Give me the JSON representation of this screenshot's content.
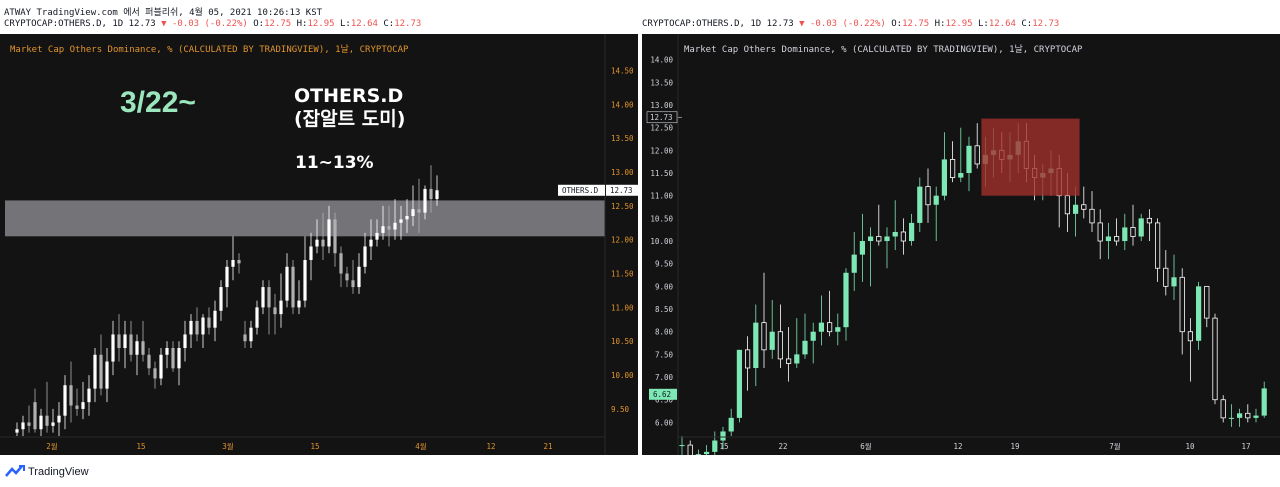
{
  "header": {
    "publish_line": "ATWAY TradingView.com 에서 퍼블리쉬, 4월 05, 2021 10:26:13 KST",
    "left_symbol": "CRYPTOCAP:OTHERS.D, 1D 12.73",
    "right_symbol": "CRYPTOCAP:OTHERS.D, 1D 12.73",
    "change": "▼ -0.03 (-0.22%)",
    "o_label": "O:",
    "o_value": "12.75",
    "h_label": "H:",
    "h_value": "12.95",
    "l_label": "L:",
    "l_value": "12.64",
    "c_label": "C:",
    "c_value": "12.73"
  },
  "colors": {
    "panel_bg": "#131313",
    "left_title": "#e0942c",
    "right_title": "#d1d4dc",
    "left_axis": "#e0942c",
    "right_axis": "#d1d4dc",
    "candle_up_left": "#ffffff",
    "candle_down_left": "#b0b0b0",
    "candle_up_right": "#7ee8b4",
    "candle_down_right": "#ffffff",
    "zone": "#8a8a8f",
    "box": "#a3302b",
    "annotation_green": "#9be6bc",
    "annotation_white": "#ffffff"
  },
  "left_panel": {
    "title": "Market Cap Others Dominance, % (CALCULATED BY TRADINGVIEW), 1날, CRYPTOCAP",
    "annotation_date": "3/22~",
    "annotation_name_1": "OTHERS.D",
    "annotation_name_2": "(잡알트 도미)",
    "annotation_range": "11~13%",
    "price_tag_symbol": "OTHERS.D",
    "price_tag_value": "12.73"
  },
  "right_panel": {
    "title": "Market Cap Others Dominance, % (CALCULATED BY TRADINGVIEW), 1날, CRYPTOCAP",
    "price_tag_value": "12.73",
    "low_tag_value": "6.62"
  },
  "footer": {
    "brand": "TradingView"
  },
  "chart_data": [
    {
      "type": "candlestick",
      "name": "left",
      "ylim": [
        9.1,
        14.95
      ],
      "y_ticks": [
        9.5,
        10.0,
        10.5,
        11.0,
        11.5,
        12.0,
        12.5,
        13.0,
        13.5,
        14.0,
        14.5
      ],
      "x_ticks": [
        "2월",
        "15",
        "3월",
        "15",
        "4월",
        "12",
        "21"
      ],
      "zone": [
        12.05,
        12.58
      ],
      "candles": [
        [
          9.15,
          9.3,
          9.1,
          9.2
        ],
        [
          9.2,
          9.4,
          9.1,
          9.3
        ],
        [
          9.3,
          9.55,
          9.15,
          9.25
        ],
        [
          9.6,
          9.8,
          9.15,
          9.2
        ],
        [
          9.2,
          9.5,
          9.1,
          9.4
        ],
        [
          9.4,
          9.9,
          9.15,
          9.25
        ],
        [
          9.25,
          9.5,
          9.15,
          9.3
        ],
        [
          9.3,
          9.6,
          9.1,
          9.4
        ],
        [
          9.4,
          10.0,
          9.2,
          9.85
        ],
        [
          9.85,
          10.2,
          9.3,
          9.55
        ],
        [
          9.55,
          9.8,
          9.4,
          9.5
        ],
        [
          9.5,
          9.9,
          9.35,
          9.6
        ],
        [
          9.6,
          10.0,
          9.4,
          9.8
        ],
        [
          9.8,
          10.4,
          9.6,
          10.3
        ],
        [
          10.3,
          10.6,
          9.7,
          9.8
        ],
        [
          9.8,
          10.4,
          9.6,
          10.2
        ],
        [
          10.2,
          10.8,
          10.0,
          10.6
        ],
        [
          10.6,
          10.9,
          10.2,
          10.4
        ],
        [
          10.4,
          10.8,
          10.1,
          10.6
        ],
        [
          10.6,
          10.8,
          10.2,
          10.3
        ],
        [
          10.3,
          10.6,
          10.0,
          10.5
        ],
        [
          10.5,
          10.8,
          10.2,
          10.3
        ],
        [
          10.3,
          10.4,
          10.0,
          10.1
        ],
        [
          10.1,
          10.2,
          9.8,
          9.95
        ],
        [
          9.95,
          10.4,
          9.85,
          10.3
        ],
        [
          10.3,
          10.5,
          10.1,
          10.4
        ],
        [
          10.4,
          10.5,
          10.05,
          10.1
        ],
        [
          10.1,
          10.5,
          9.85,
          10.4
        ],
        [
          10.4,
          10.8,
          10.2,
          10.6
        ],
        [
          10.6,
          10.9,
          10.4,
          10.8
        ],
        [
          10.8,
          11.0,
          10.5,
          10.6
        ],
        [
          10.6,
          10.9,
          10.4,
          10.85
        ],
        [
          10.85,
          11.0,
          10.6,
          10.7
        ],
        [
          10.7,
          11.1,
          10.5,
          10.95
        ],
        [
          10.95,
          11.4,
          10.8,
          11.3
        ],
        [
          11.3,
          11.7,
          11.0,
          11.6
        ],
        [
          11.6,
          12.05,
          11.4,
          11.7
        ],
        [
          11.7,
          11.8,
          11.5,
          11.65
        ],
        [
          10.6,
          10.8,
          10.4,
          10.5
        ],
        [
          10.5,
          10.8,
          10.4,
          10.7
        ],
        [
          10.7,
          11.1,
          10.6,
          11.0
        ],
        [
          11.0,
          11.4,
          10.9,
          11.3
        ],
        [
          11.3,
          11.4,
          10.6,
          11.0
        ],
        [
          11.0,
          11.2,
          10.6,
          10.9
        ],
        [
          10.9,
          11.5,
          10.7,
          11.1
        ],
        [
          11.1,
          11.8,
          11.0,
          11.6
        ],
        [
          11.6,
          11.7,
          10.9,
          11.0
        ],
        [
          11.0,
          11.4,
          10.9,
          11.1
        ],
        [
          11.1,
          12.05,
          11.0,
          11.7
        ],
        [
          11.7,
          12.1,
          11.4,
          11.9
        ],
        [
          11.9,
          12.3,
          11.8,
          12.0
        ],
        [
          12.0,
          12.4,
          11.7,
          11.9
        ],
        [
          11.9,
          12.5,
          11.8,
          12.3
        ],
        [
          12.3,
          12.4,
          11.6,
          11.8
        ],
        [
          11.8,
          11.9,
          11.3,
          11.5
        ],
        [
          11.5,
          11.6,
          11.3,
          11.4
        ],
        [
          11.4,
          11.7,
          11.2,
          11.3
        ],
        [
          11.3,
          11.8,
          11.2,
          11.6
        ],
        [
          11.6,
          12.1,
          11.5,
          11.9
        ],
        [
          11.9,
          12.3,
          11.7,
          12.0
        ],
        [
          12.0,
          12.3,
          11.9,
          12.1
        ],
        [
          12.1,
          12.5,
          12.0,
          12.2
        ],
        [
          12.2,
          12.5,
          11.9,
          12.15
        ],
        [
          12.15,
          12.6,
          12.0,
          12.25
        ],
        [
          12.25,
          12.5,
          12.0,
          12.3
        ],
        [
          12.3,
          12.6,
          12.1,
          12.35
        ],
        [
          12.35,
          12.8,
          12.2,
          12.45
        ],
        [
          12.45,
          12.9,
          12.1,
          12.4
        ],
        [
          12.4,
          12.8,
          12.3,
          12.75
        ],
        [
          12.75,
          13.1,
          12.4,
          12.6
        ],
        [
          12.6,
          12.95,
          12.5,
          12.73
        ]
      ]
    },
    {
      "type": "candlestick",
      "name": "right",
      "ylim": [
        5.7,
        14.5
      ],
      "y_ticks": [
        6.0,
        6.5,
        7.0,
        7.5,
        8.0,
        8.5,
        9.0,
        9.5,
        10.0,
        10.5,
        11.0,
        11.5,
        12.0,
        12.5,
        13.0,
        13.5,
        14.0
      ],
      "x_ticks": [
        "15",
        "22",
        "6월",
        "12",
        "19",
        "7월",
        "10",
        "17"
      ],
      "box": {
        "from": 37,
        "to": 48,
        "low": 11.0,
        "high": 12.7
      },
      "candles": [
        [
          5.5,
          5.7,
          5.2,
          5.5
        ],
        [
          5.5,
          5.6,
          5.1,
          5.2
        ],
        [
          5.2,
          5.4,
          5.0,
          5.3
        ],
        [
          5.3,
          5.5,
          5.1,
          5.35
        ],
        [
          5.35,
          5.8,
          5.2,
          5.6
        ],
        [
          5.6,
          5.9,
          5.4,
          5.8
        ],
        [
          5.8,
          6.3,
          5.7,
          6.1
        ],
        [
          6.1,
          7.6,
          6.0,
          7.6
        ],
        [
          7.6,
          7.9,
          6.7,
          7.2
        ],
        [
          7.2,
          8.6,
          6.8,
          8.2
        ],
        [
          8.2,
          9.3,
          7.2,
          7.6
        ],
        [
          7.6,
          8.7,
          7.4,
          8.0
        ],
        [
          8.0,
          8.6,
          7.2,
          7.4
        ],
        [
          7.4,
          8.1,
          6.9,
          7.3
        ],
        [
          7.3,
          8.3,
          7.2,
          7.5
        ],
        [
          7.5,
          8.4,
          7.4,
          7.8
        ],
        [
          7.8,
          8.2,
          7.3,
          8.0
        ],
        [
          8.0,
          8.8,
          7.7,
          8.2
        ],
        [
          8.2,
          8.9,
          7.9,
          8.0
        ],
        [
          8.0,
          8.4,
          7.7,
          8.1
        ],
        [
          8.1,
          9.4,
          7.8,
          9.3
        ],
        [
          9.3,
          10.2,
          8.9,
          9.7
        ],
        [
          9.7,
          10.6,
          9.1,
          10.0
        ],
        [
          10.0,
          10.3,
          9.0,
          10.1
        ],
        [
          10.1,
          10.8,
          9.9,
          10.0
        ],
        [
          10.0,
          10.3,
          9.4,
          10.1
        ],
        [
          10.1,
          10.9,
          9.8,
          10.2
        ],
        [
          10.2,
          10.5,
          9.7,
          10.0
        ],
        [
          10.0,
          10.6,
          9.9,
          10.4
        ],
        [
          10.4,
          11.4,
          10.2,
          11.2
        ],
        [
          11.2,
          11.6,
          10.4,
          10.8
        ],
        [
          10.8,
          11.2,
          10.0,
          11.0
        ],
        [
          11.0,
          12.4,
          10.9,
          11.8
        ],
        [
          11.8,
          12.2,
          11.3,
          11.4
        ],
        [
          11.4,
          12.5,
          11.3,
          11.5
        ],
        [
          11.5,
          12.3,
          11.1,
          12.1
        ],
        [
          12.1,
          12.6,
          11.6,
          11.7
        ],
        [
          11.7,
          12.3,
          11.2,
          11.9
        ],
        [
          11.9,
          12.5,
          11.4,
          12.0
        ],
        [
          12.0,
          12.4,
          11.5,
          11.8
        ],
        [
          11.8,
          12.4,
          11.3,
          11.9
        ],
        [
          11.9,
          12.6,
          11.5,
          12.2
        ],
        [
          12.2,
          12.6,
          11.3,
          11.6
        ],
        [
          11.6,
          11.9,
          10.9,
          11.4
        ],
        [
          11.4,
          11.7,
          10.9,
          11.5
        ],
        [
          11.5,
          12.0,
          11.0,
          11.6
        ],
        [
          11.6,
          11.9,
          10.3,
          11.0
        ],
        [
          11.0,
          11.5,
          10.2,
          10.6
        ],
        [
          10.6,
          11.2,
          10.1,
          10.8
        ],
        [
          10.8,
          11.2,
          10.5,
          10.7
        ],
        [
          10.7,
          11.1,
          10.2,
          10.4
        ],
        [
          10.4,
          10.7,
          9.6,
          10.0
        ],
        [
          10.0,
          10.4,
          9.6,
          10.1
        ],
        [
          10.1,
          10.5,
          9.9,
          10.0
        ],
        [
          10.0,
          10.6,
          9.8,
          10.3
        ],
        [
          10.3,
          10.8,
          9.9,
          10.1
        ],
        [
          10.1,
          10.6,
          10.0,
          10.5
        ],
        [
          10.5,
          10.7,
          10.0,
          10.4
        ],
        [
          10.4,
          10.5,
          9.1,
          9.4
        ],
        [
          9.4,
          9.8,
          8.8,
          9.0
        ],
        [
          9.0,
          9.7,
          8.7,
          9.2
        ],
        [
          9.2,
          9.4,
          7.5,
          8.0
        ],
        [
          8.0,
          8.3,
          6.9,
          7.8
        ],
        [
          7.8,
          9.1,
          7.6,
          9.0
        ],
        [
          9.0,
          9.0,
          8.1,
          8.3
        ],
        [
          8.3,
          8.4,
          6.4,
          6.5
        ],
        [
          6.5,
          6.6,
          6.0,
          6.1
        ],
        [
          6.1,
          6.4,
          5.9,
          6.1
        ],
        [
          6.1,
          6.3,
          5.9,
          6.2
        ],
        [
          6.2,
          6.4,
          6.0,
          6.1
        ],
        [
          6.1,
          6.3,
          6.0,
          6.15
        ],
        [
          6.15,
          6.9,
          6.1,
          6.75
        ]
      ]
    }
  ]
}
